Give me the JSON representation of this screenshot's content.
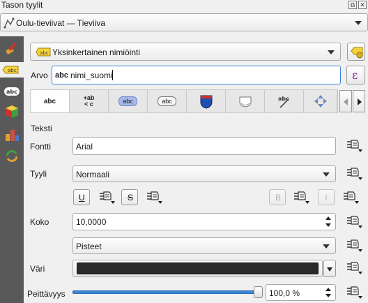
{
  "window": {
    "title": "Tason tyylit"
  },
  "layer_select": {
    "value": "Oulu-tieviivat — Tieviiva"
  },
  "label_mode": {
    "value": "Yksinkertainen nimiöinti",
    "icon_text": "abc"
  },
  "value_row": {
    "label": "Arvo",
    "prefix": "abc",
    "value": "nimi_suomi",
    "expr_glyph": "ε"
  },
  "tabs": [
    {
      "name": "text",
      "glyph": "abc"
    },
    {
      "name": "formatting",
      "glyph": "+ab <c"
    },
    {
      "name": "buffer",
      "glyph": "abc"
    },
    {
      "name": "background",
      "glyph": "abc"
    },
    {
      "name": "shadow",
      "glyph": ""
    },
    {
      "name": "callouts",
      "glyph": ""
    },
    {
      "name": "placement",
      "glyph": "abc"
    },
    {
      "name": "rendering",
      "glyph": ""
    }
  ],
  "section": {
    "title": "Teksti"
  },
  "font": {
    "label": "Fontti",
    "value": "Arial"
  },
  "style": {
    "label": "Tyyli",
    "value": "Normaali"
  },
  "format_buttons": {
    "underline": "U",
    "strikeout": "S",
    "bold": "B",
    "italic": "I"
  },
  "size": {
    "label": "Koko",
    "value": "10,0000"
  },
  "units": {
    "value": "Pisteet"
  },
  "color": {
    "label": "Väri",
    "swatch": "#2b2b2b"
  },
  "opacity": {
    "label": "Peittävyys",
    "value": "100,0 %",
    "level": 1.0
  },
  "colors": {
    "accent": "#3b85d8",
    "sidebar": "#595959"
  }
}
